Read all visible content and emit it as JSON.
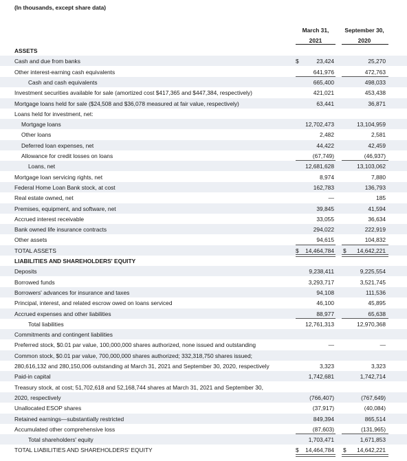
{
  "note": "(In thousands, except share data)",
  "columns": {
    "col1_line1": "March 31,",
    "col1_line2": "2021",
    "col2_line1": "September 30,",
    "col2_line2": "2020"
  },
  "rows": [
    {
      "label": "ASSETS",
      "v1": "",
      "v2": ""
    },
    {
      "label": "Cash and due from banks",
      "v1": "23,424",
      "v2": "25,270",
      "dollar1": "$",
      "dollar2": ""
    },
    {
      "label": "Other interest-earning cash equivalents",
      "v1": "641,976",
      "v2": "472,763"
    },
    {
      "label": "Cash and cash equivalents",
      "v1": "665,400",
      "v2": "498,033"
    },
    {
      "label": "Investment securities available for sale (amortized cost $417,365 and $447,384, respectively)",
      "v1": "421,021",
      "v2": "453,438"
    },
    {
      "label": "Mortgage loans held for sale ($24,508 and $36,078 measured at fair value, respectively)",
      "v1": "63,441",
      "v2": "36,871"
    },
    {
      "label": "Loans held for investment, net:",
      "v1": "",
      "v2": ""
    },
    {
      "label": "Mortgage loans",
      "v1": "12,702,473",
      "v2": "13,104,959"
    },
    {
      "label": "Other loans",
      "v1": "2,482",
      "v2": "2,581"
    },
    {
      "label": "Deferred loan expenses, net",
      "v1": "44,422",
      "v2": "42,459"
    },
    {
      "label": "Allowance for credit losses on loans",
      "v1": "(67,749)",
      "v2": "(46,937)"
    },
    {
      "label": "Loans, net",
      "v1": "12,681,628",
      "v2": "13,103,062"
    },
    {
      "label": "Mortgage loan servicing rights, net",
      "v1": "8,974",
      "v2": "7,880"
    },
    {
      "label": "Federal Home Loan Bank stock, at cost",
      "v1": "162,783",
      "v2": "136,793"
    },
    {
      "label": "Real estate owned, net",
      "v1": "—",
      "v2": "185"
    },
    {
      "label": "Premises, equipment, and software, net",
      "v1": "39,845",
      "v2": "41,594"
    },
    {
      "label": "Accrued interest receivable",
      "v1": "33,055",
      "v2": "36,634"
    },
    {
      "label": "Bank owned life insurance contracts",
      "v1": "294,022",
      "v2": "222,919"
    },
    {
      "label": "Other assets",
      "v1": "94,615",
      "v2": "104,832"
    },
    {
      "label": "TOTAL ASSETS",
      "v1": "14,464,784",
      "v2": "14,642,221",
      "dollar1": "$",
      "dollar2": "$"
    },
    {
      "label": "LIABILITIES AND SHAREHOLDERS' EQUITY",
      "v1": "",
      "v2": ""
    },
    {
      "label": "Deposits",
      "v1": "9,238,411",
      "v2": "9,225,554"
    },
    {
      "label": "Borrowed funds",
      "v1": "3,293,717",
      "v2": "3,521,745"
    },
    {
      "label": "Borrowers' advances for insurance and taxes",
      "v1": "94,108",
      "v2": "111,536"
    },
    {
      "label": "Principal, interest, and related escrow owed on loans serviced",
      "v1": "46,100",
      "v2": "45,895"
    },
    {
      "label": "Accrued expenses and other liabilities",
      "v1": "88,977",
      "v2": "65,638"
    },
    {
      "label": "Total liabilities",
      "v1": "12,761,313",
      "v2": "12,970,368"
    },
    {
      "label": "Commitments and contingent liabilities",
      "v1": "",
      "v2": ""
    },
    {
      "label": "Preferred stock, $0.01 par value, 100,000,000 shares authorized, none issued and outstanding",
      "v1": "—",
      "v2": "—"
    },
    {
      "label": "Common stock, $0.01 par value, 700,000,000 shares authorized; 332,318,750 shares issued;",
      "v1": "",
      "v2": ""
    },
    {
      "label": "280,616,132 and 280,150,006 outstanding at March 31, 2021 and September 30, 2020, respectively",
      "v1": "3,323",
      "v2": "3,323"
    },
    {
      "label": "Paid-in capital",
      "v1": "1,742,681",
      "v2": "1,742,714"
    },
    {
      "label": "Treasury stock, at cost; 51,702,618 and 52,168,744 shares at March 31, 2021 and September 30,",
      "v1": "",
      "v2": ""
    },
    {
      "label": "2020, respectively",
      "v1": "(766,407)",
      "v2": "(767,649)"
    },
    {
      "label": "Unallocated ESOP shares",
      "v1": "(37,917)",
      "v2": "(40,084)"
    },
    {
      "label": "Retained earnings—substantially restricted",
      "v1": "849,394",
      "v2": "865,514"
    },
    {
      "label": "Accumulated other comprehensive loss",
      "v1": "(87,603)",
      "v2": "(131,965)"
    },
    {
      "label": "Total shareholders' equity",
      "v1": "1,703,471",
      "v2": "1,671,853"
    },
    {
      "label": "TOTAL LIABILITIES AND SHAREHOLDERS' EQUITY",
      "v1": "14,464,784",
      "v2": "14,642,221",
      "dollar1": "$",
      "dollar2": "$"
    }
  ]
}
